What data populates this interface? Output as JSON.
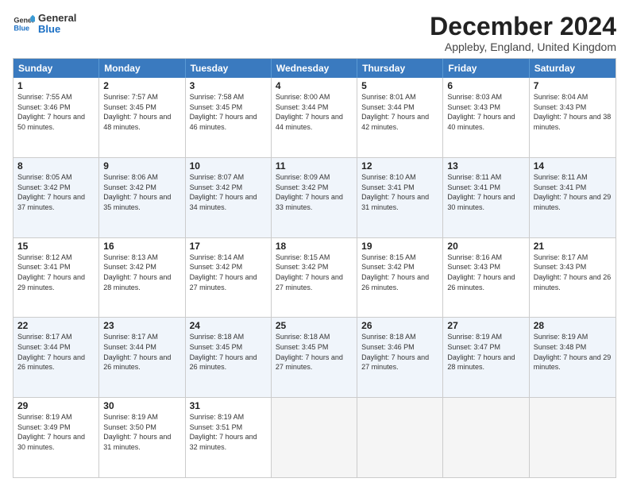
{
  "header": {
    "logo_general": "General",
    "logo_blue": "Blue",
    "title": "December 2024",
    "subtitle": "Appleby, England, United Kingdom"
  },
  "days_of_week": [
    "Sunday",
    "Monday",
    "Tuesday",
    "Wednesday",
    "Thursday",
    "Friday",
    "Saturday"
  ],
  "weeks": [
    [
      {
        "day": "1",
        "sunrise": "Sunrise: 7:55 AM",
        "sunset": "Sunset: 3:46 PM",
        "daylight": "Daylight: 7 hours and 50 minutes."
      },
      {
        "day": "2",
        "sunrise": "Sunrise: 7:57 AM",
        "sunset": "Sunset: 3:45 PM",
        "daylight": "Daylight: 7 hours and 48 minutes."
      },
      {
        "day": "3",
        "sunrise": "Sunrise: 7:58 AM",
        "sunset": "Sunset: 3:45 PM",
        "daylight": "Daylight: 7 hours and 46 minutes."
      },
      {
        "day": "4",
        "sunrise": "Sunrise: 8:00 AM",
        "sunset": "Sunset: 3:44 PM",
        "daylight": "Daylight: 7 hours and 44 minutes."
      },
      {
        "day": "5",
        "sunrise": "Sunrise: 8:01 AM",
        "sunset": "Sunset: 3:44 PM",
        "daylight": "Daylight: 7 hours and 42 minutes."
      },
      {
        "day": "6",
        "sunrise": "Sunrise: 8:03 AM",
        "sunset": "Sunset: 3:43 PM",
        "daylight": "Daylight: 7 hours and 40 minutes."
      },
      {
        "day": "7",
        "sunrise": "Sunrise: 8:04 AM",
        "sunset": "Sunset: 3:43 PM",
        "daylight": "Daylight: 7 hours and 38 minutes."
      }
    ],
    [
      {
        "day": "8",
        "sunrise": "Sunrise: 8:05 AM",
        "sunset": "Sunset: 3:42 PM",
        "daylight": "Daylight: 7 hours and 37 minutes."
      },
      {
        "day": "9",
        "sunrise": "Sunrise: 8:06 AM",
        "sunset": "Sunset: 3:42 PM",
        "daylight": "Daylight: 7 hours and 35 minutes."
      },
      {
        "day": "10",
        "sunrise": "Sunrise: 8:07 AM",
        "sunset": "Sunset: 3:42 PM",
        "daylight": "Daylight: 7 hours and 34 minutes."
      },
      {
        "day": "11",
        "sunrise": "Sunrise: 8:09 AM",
        "sunset": "Sunset: 3:42 PM",
        "daylight": "Daylight: 7 hours and 33 minutes."
      },
      {
        "day": "12",
        "sunrise": "Sunrise: 8:10 AM",
        "sunset": "Sunset: 3:41 PM",
        "daylight": "Daylight: 7 hours and 31 minutes."
      },
      {
        "day": "13",
        "sunrise": "Sunrise: 8:11 AM",
        "sunset": "Sunset: 3:41 PM",
        "daylight": "Daylight: 7 hours and 30 minutes."
      },
      {
        "day": "14",
        "sunrise": "Sunrise: 8:11 AM",
        "sunset": "Sunset: 3:41 PM",
        "daylight": "Daylight: 7 hours and 29 minutes."
      }
    ],
    [
      {
        "day": "15",
        "sunrise": "Sunrise: 8:12 AM",
        "sunset": "Sunset: 3:41 PM",
        "daylight": "Daylight: 7 hours and 29 minutes."
      },
      {
        "day": "16",
        "sunrise": "Sunrise: 8:13 AM",
        "sunset": "Sunset: 3:42 PM",
        "daylight": "Daylight: 7 hours and 28 minutes."
      },
      {
        "day": "17",
        "sunrise": "Sunrise: 8:14 AM",
        "sunset": "Sunset: 3:42 PM",
        "daylight": "Daylight: 7 hours and 27 minutes."
      },
      {
        "day": "18",
        "sunrise": "Sunrise: 8:15 AM",
        "sunset": "Sunset: 3:42 PM",
        "daylight": "Daylight: 7 hours and 27 minutes."
      },
      {
        "day": "19",
        "sunrise": "Sunrise: 8:15 AM",
        "sunset": "Sunset: 3:42 PM",
        "daylight": "Daylight: 7 hours and 26 minutes."
      },
      {
        "day": "20",
        "sunrise": "Sunrise: 8:16 AM",
        "sunset": "Sunset: 3:43 PM",
        "daylight": "Daylight: 7 hours and 26 minutes."
      },
      {
        "day": "21",
        "sunrise": "Sunrise: 8:17 AM",
        "sunset": "Sunset: 3:43 PM",
        "daylight": "Daylight: 7 hours and 26 minutes."
      }
    ],
    [
      {
        "day": "22",
        "sunrise": "Sunrise: 8:17 AM",
        "sunset": "Sunset: 3:44 PM",
        "daylight": "Daylight: 7 hours and 26 minutes."
      },
      {
        "day": "23",
        "sunrise": "Sunrise: 8:17 AM",
        "sunset": "Sunset: 3:44 PM",
        "daylight": "Daylight: 7 hours and 26 minutes."
      },
      {
        "day": "24",
        "sunrise": "Sunrise: 8:18 AM",
        "sunset": "Sunset: 3:45 PM",
        "daylight": "Daylight: 7 hours and 26 minutes."
      },
      {
        "day": "25",
        "sunrise": "Sunrise: 8:18 AM",
        "sunset": "Sunset: 3:45 PM",
        "daylight": "Daylight: 7 hours and 27 minutes."
      },
      {
        "day": "26",
        "sunrise": "Sunrise: 8:18 AM",
        "sunset": "Sunset: 3:46 PM",
        "daylight": "Daylight: 7 hours and 27 minutes."
      },
      {
        "day": "27",
        "sunrise": "Sunrise: 8:19 AM",
        "sunset": "Sunset: 3:47 PM",
        "daylight": "Daylight: 7 hours and 28 minutes."
      },
      {
        "day": "28",
        "sunrise": "Sunrise: 8:19 AM",
        "sunset": "Sunset: 3:48 PM",
        "daylight": "Daylight: 7 hours and 29 minutes."
      }
    ],
    [
      {
        "day": "29",
        "sunrise": "Sunrise: 8:19 AM",
        "sunset": "Sunset: 3:49 PM",
        "daylight": "Daylight: 7 hours and 30 minutes."
      },
      {
        "day": "30",
        "sunrise": "Sunrise: 8:19 AM",
        "sunset": "Sunset: 3:50 PM",
        "daylight": "Daylight: 7 hours and 31 minutes."
      },
      {
        "day": "31",
        "sunrise": "Sunrise: 8:19 AM",
        "sunset": "Sunset: 3:51 PM",
        "daylight": "Daylight: 7 hours and 32 minutes."
      },
      null,
      null,
      null,
      null
    ]
  ]
}
